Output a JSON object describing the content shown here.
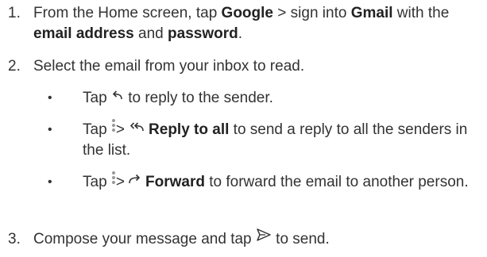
{
  "steps": [
    {
      "num": "1.",
      "t1": "From the Home screen, tap ",
      "b1": "Google",
      "t2": " > sign into ",
      "b2": "Gmail",
      "t3": " with the ",
      "b3": "email address",
      "t4": " and ",
      "b4": "password",
      "t5": "."
    },
    {
      "num": "2.",
      "text": "Select the email from your inbox to read."
    },
    {
      "num": "3.",
      "before": "Compose your message and tap ",
      "icon": "send-icon",
      "after": " to send."
    }
  ],
  "bullets": [
    {
      "marker": "•",
      "before": "Tap ",
      "icon": "reply-icon",
      "after": " to reply to the sender."
    },
    {
      "marker": "•",
      "before": "Tap ",
      "icon1": "more-vert-icon",
      "sep": ">",
      "icon2": "reply-all-icon",
      "bold": "Reply to all",
      "after": " to send a reply to all the senders in the list."
    },
    {
      "marker": "•",
      "before": "Tap ",
      "icon1": "more-vert-icon",
      "sep": ">",
      "icon2": "forward-icon",
      "bold": "Forward",
      "after": " to forward the email to another person."
    }
  ]
}
